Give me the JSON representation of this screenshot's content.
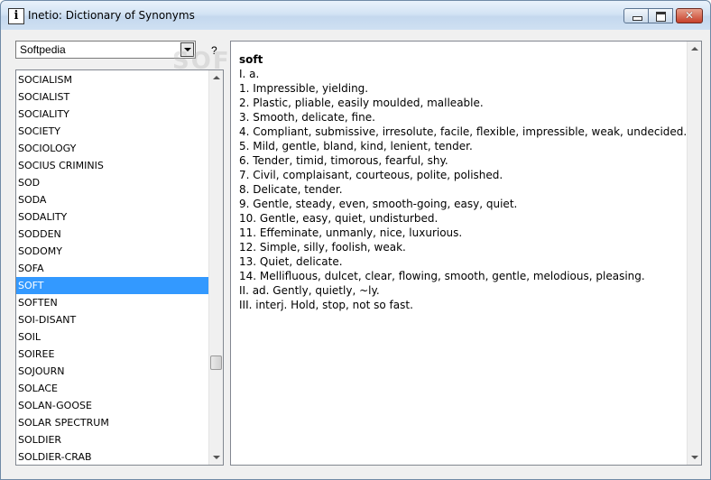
{
  "window": {
    "title": "Inetio: Dictionary of Synonyms",
    "app_icon": "i"
  },
  "source_dropdown": {
    "selected": "Softpedia"
  },
  "help": {
    "label": "?"
  },
  "word_list": {
    "items": [
      "SOCIALISM",
      "SOCIALIST",
      "SOCIALITY",
      "SOCIETY",
      "SOCIOLOGY",
      "SOCIUS CRIMINIS",
      "SOD",
      "SODA",
      "SODALITY",
      "SODDEN",
      "SODOMY",
      "SOFA",
      "SOFT",
      "SOFTEN",
      "SOI-DISANT",
      "SOIL",
      "SOIREE",
      "SOJOURN",
      "SOLACE",
      "SOLAN-GOOSE",
      "SOLAR SPECTRUM",
      "SOLDIER",
      "SOLDIER-CRAB"
    ],
    "selected": "SOFT",
    "scroll_position": 0.77
  },
  "definition": {
    "headword": "soft",
    "lines": [
      "I. a.",
      "1. Impressible, yielding.",
      "2. Plastic, pliable, easily moulded, malleable.",
      "3. Smooth, delicate, fine.",
      "4. Compliant, submissive, irresolute, facile, flexible, impressible, weak, undecided.",
      "5. Mild, gentle, bland, kind, lenient, tender.",
      "6. Tender, timid, timorous, fearful, shy.",
      "7. Civil, complaisant, courteous, polite, polished.",
      "8. Delicate, tender.",
      "9. Gentle, steady, even, smooth-going, easy, quiet.",
      "10. Gentle, easy, quiet, undisturbed.",
      "11. Effeminate, unmanly, nice, luxurious.",
      "12. Simple, silly, foolish, weak.",
      "13. Quiet, delicate.",
      "14. Mellifluous, dulcet, clear, flowing, smooth, gentle, melodious, pleasing.",
      "II. ad. Gently, quietly, ~ly.",
      "III. interj. Hold, stop, not so fast."
    ]
  },
  "watermark": "SOFTPEDIA",
  "colors": {
    "selection": "#3399ff",
    "titlebar": "#d3e3f4",
    "close_button": "#c7402a"
  },
  "icons": {
    "minimize": "minimize-icon",
    "maximize": "maximize-icon",
    "close": "close-icon",
    "dropdown": "chevron-down-icon"
  }
}
